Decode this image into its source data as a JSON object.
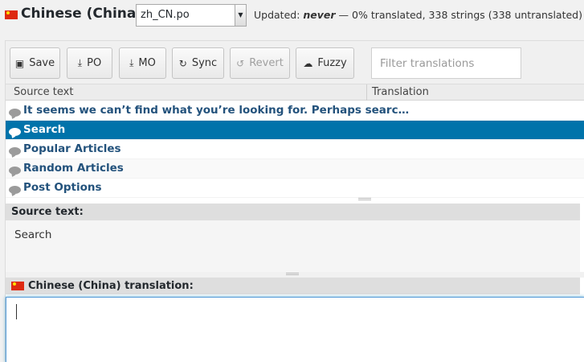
{
  "header": {
    "language": "Chinese (China):",
    "po_file": "zh_CN.po",
    "status_prefix": "Updated: ",
    "status_never": "never",
    "status_suffix": " — 0% translated, 338 strings (338 untranslated)"
  },
  "toolbar": {
    "save": "Save",
    "po": "PO",
    "mo": "MO",
    "sync": "Sync",
    "revert": "Revert",
    "fuzzy": "Fuzzy",
    "filter_placeholder": "Filter translations"
  },
  "columns": {
    "source": "Source text",
    "translation": "Translation"
  },
  "rows": [
    {
      "text": "It seems we can’t find what you’re looking for. Perhaps searc…",
      "selected": false
    },
    {
      "text": "Search",
      "selected": true
    },
    {
      "text": "Popular Articles",
      "selected": false
    },
    {
      "text": "Random Articles",
      "selected": false
    },
    {
      "text": "Post Options",
      "selected": false
    }
  ],
  "source_panel": {
    "heading": "Source text:",
    "value": "Search"
  },
  "translation_panel": {
    "heading": "Chinese (China) translation:",
    "value": ""
  },
  "icons": {
    "flag": "china-flag-icon",
    "save": "floppy-icon",
    "po": "download-icon",
    "mo": "download-icon",
    "sync": "refresh-icon",
    "revert": "undo-icon",
    "fuzzy": "cloud-icon",
    "row": "speech-bubble-icon"
  },
  "colors": {
    "accent": "#0073aa",
    "row_text": "#23527c",
    "flag_red": "#de2910",
    "flag_star": "#ffde00"
  }
}
